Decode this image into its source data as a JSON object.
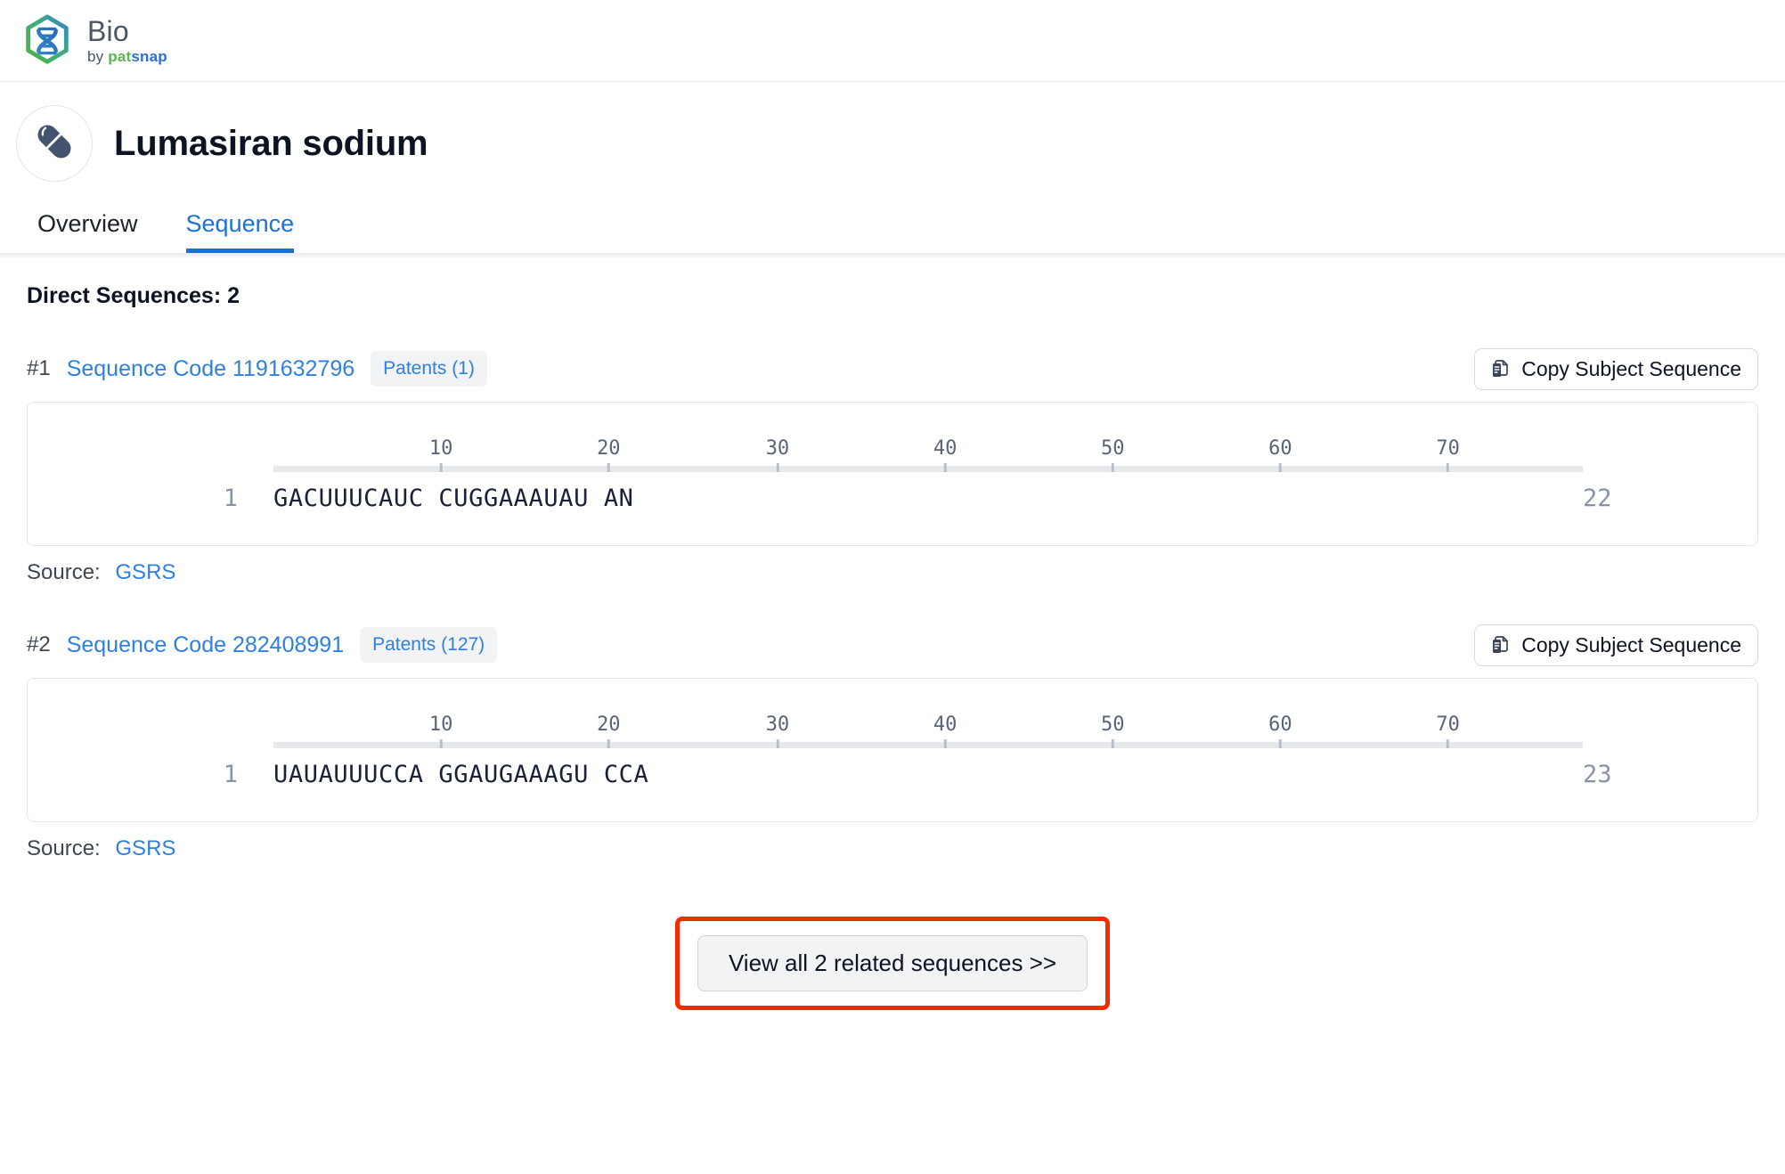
{
  "brand": {
    "logo_icon": "dna-hexagon-logo",
    "name": "Bio",
    "by": "by ",
    "by_pat": "pat",
    "by_snap": "snap"
  },
  "drug": {
    "avatar_icon": "capsule-icon",
    "title": "Lumasiran sodium"
  },
  "tabs": [
    {
      "label": "Overview",
      "active": false
    },
    {
      "label": "Sequence",
      "active": true
    }
  ],
  "main": {
    "section_title": "Direct Sequences: 2",
    "copy_button_label": "Copy Subject Sequence",
    "copy_button_icon": "copy-icon",
    "source_label": "Source:",
    "ruler_ticks": [
      10,
      20,
      30,
      40,
      50,
      60,
      70
    ],
    "ruler_max": 78,
    "sequences": [
      {
        "index": "#1",
        "code_label": "Sequence Code 1191632796",
        "patents_label": "Patents (1)",
        "start": "1",
        "letters": "GACUUUCAUC CUGGAAAUAU AN",
        "end": "22",
        "source_label": "Source:",
        "source_name": "GSRS"
      },
      {
        "index": "#2",
        "code_label": "Sequence Code 282408991",
        "patents_label": "Patents (127)",
        "start": "1",
        "letters": "UAUAUUUCCA GGAUGAAAGU CCA",
        "end": "23",
        "source_label": "Source:",
        "source_name": "GSRS"
      }
    ],
    "view_all_label": "View all 2 related sequences >>"
  },
  "colors": {
    "accent_blue": "#1a73d4",
    "link_blue": "#2f80e0",
    "highlight_red": "#f42b00",
    "badge_bg": "#f1f3f5",
    "brand_green": "#5bb553"
  }
}
